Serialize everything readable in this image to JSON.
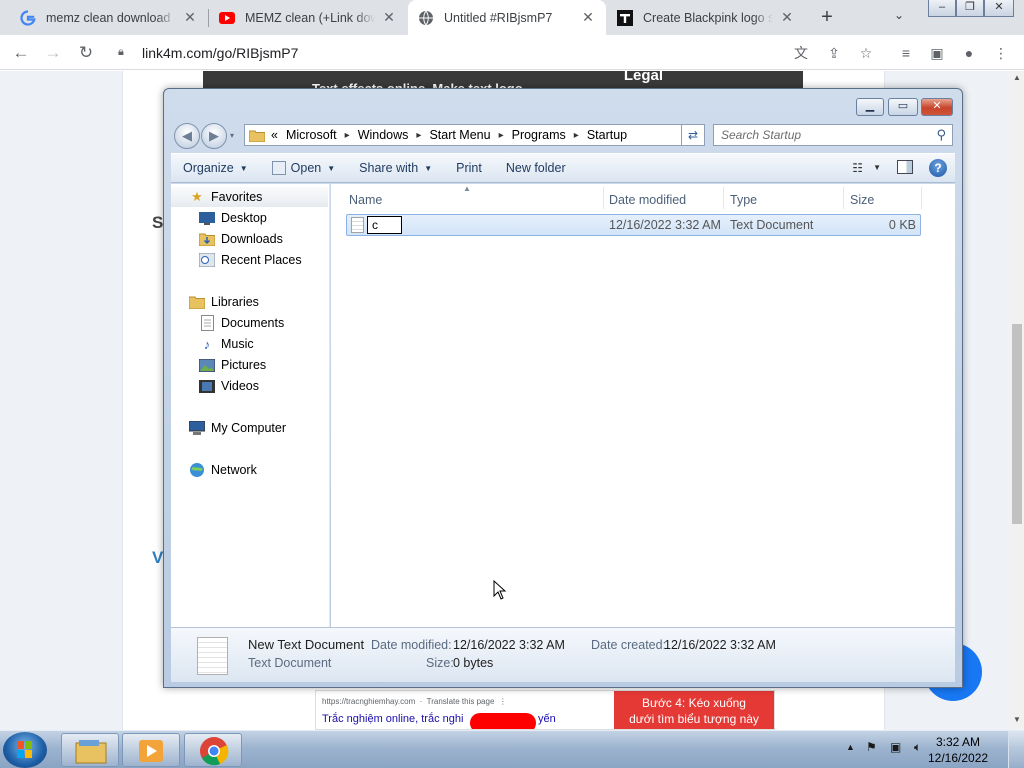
{
  "browser": {
    "tabs": [
      {
        "title": "memz clean download - •",
        "icon": "google-icon"
      },
      {
        "title": "MEMZ clean (+Link down",
        "icon": "youtube-icon"
      },
      {
        "title": "Untitled #RIBjsmP7",
        "icon": "globe-icon"
      },
      {
        "title": "Create Blackpink logo sty",
        "icon": "textpro-icon"
      }
    ],
    "url": "link4m.com/go/RIBjsmP7"
  },
  "webpage": {
    "banner_title": "Legal",
    "banner_sub": "Text effects online, Make text logo",
    "side_letters": [
      "S",
      "V"
    ],
    "ad": {
      "url": "https://tracnghiemhay.com",
      "translate": "Translate this page",
      "text": "Trắc nghiệm online, trắc nghi",
      "text_end": "yến",
      "red_line1": "Bước 4: Kéo xuống",
      "red_line2": "dưới tìm biểu tượng này"
    }
  },
  "explorer": {
    "breadcrumb_prefix": "«",
    "path": [
      "Microsoft",
      "Windows",
      "Start Menu",
      "Programs",
      "Startup"
    ],
    "search_placeholder": "Search Startup",
    "commands": {
      "organize": "Organize",
      "open": "Open",
      "share_with": "Share with",
      "print": "Print",
      "new_folder": "New folder"
    },
    "nav": {
      "favorites": "Favorites",
      "desktop": "Desktop",
      "downloads": "Downloads",
      "recent_places": "Recent Places",
      "libraries": "Libraries",
      "documents": "Documents",
      "music": "Music",
      "pictures": "Pictures",
      "videos": "Videos",
      "my_computer": "My Computer",
      "network": "Network"
    },
    "columns": {
      "name": "Name",
      "date_modified": "Date modified",
      "type": "Type",
      "size": "Size"
    },
    "file": {
      "rename_value": "c",
      "date_modified": "12/16/2022 3:32 AM",
      "type": "Text Document",
      "size": "0 KB"
    },
    "details": {
      "name": "New Text Document",
      "type": "Text Document",
      "date_modified_label": "Date modified:",
      "date_modified": "12/16/2022 3:32 AM",
      "date_created_label": "Date created:",
      "date_created": "12/16/2022 3:32 AM",
      "size_label": "Size:",
      "size": "0 bytes"
    }
  },
  "taskbar": {
    "time": "3:32 AM",
    "date": "12/16/2022"
  },
  "colors": {
    "chrome_tabstrip": "#dee1e6",
    "explorer_frame": "#b9cbe2",
    "selection": "#d2e4f8",
    "taskbar": "#9db4cf"
  }
}
